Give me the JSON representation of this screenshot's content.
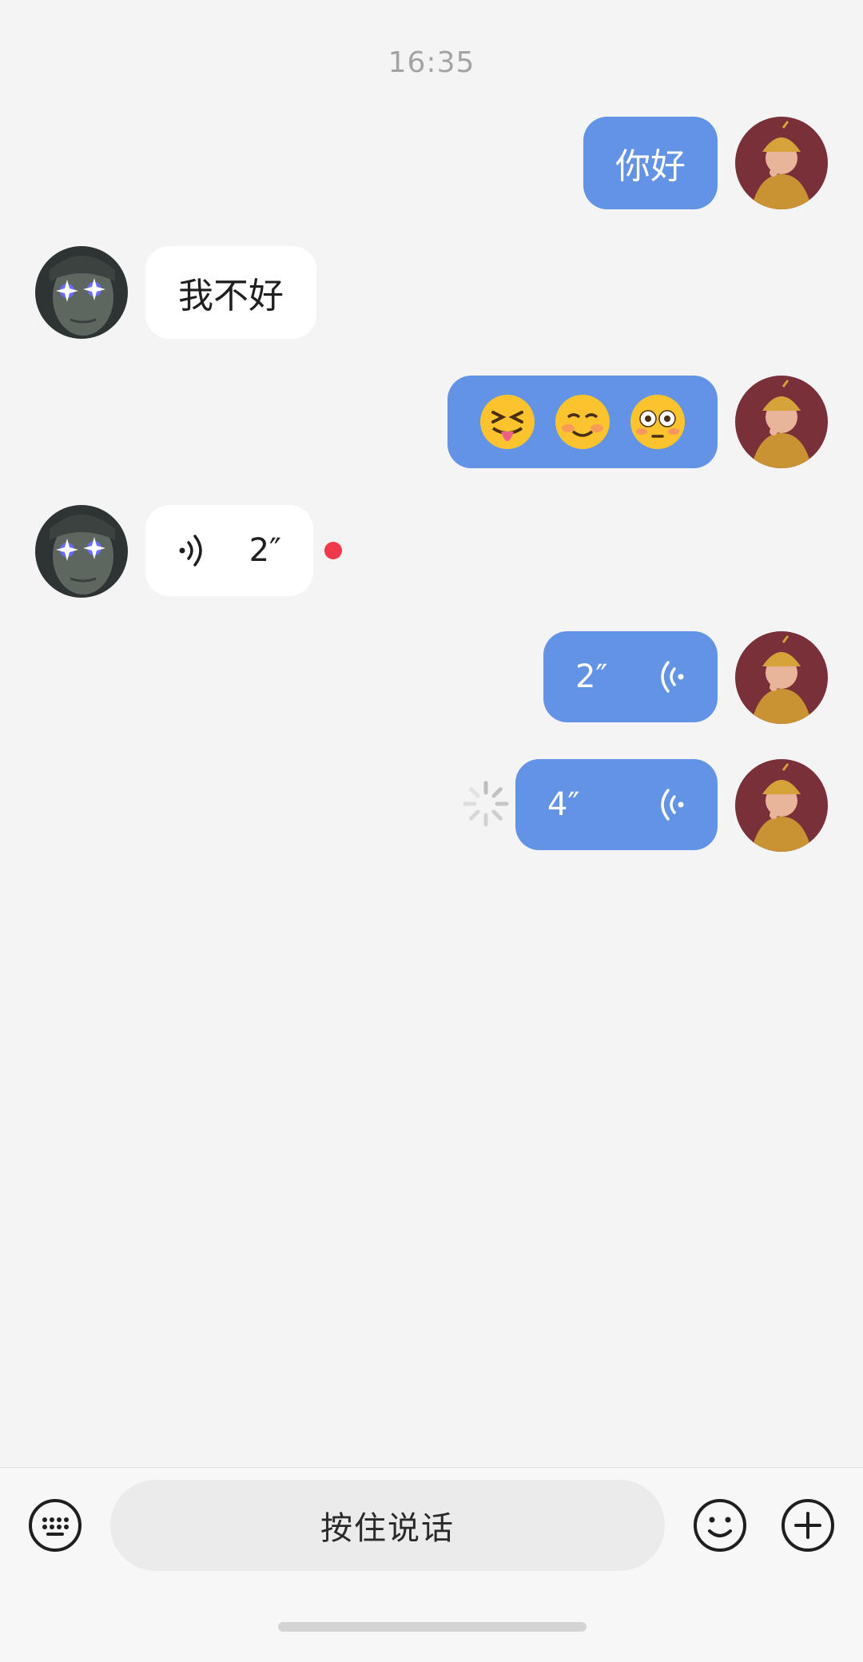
{
  "chat": {
    "timestamp": "16:35",
    "messages": [
      {
        "sender": "me",
        "type": "text",
        "text": "你好"
      },
      {
        "sender": "them",
        "type": "text",
        "text": "我不好"
      },
      {
        "sender": "me",
        "type": "emoji",
        "emojis": [
          "squinting-tongue-face",
          "smiling-face",
          "flushed-face"
        ]
      },
      {
        "sender": "them",
        "type": "voice",
        "duration": "2″",
        "unread": true
      },
      {
        "sender": "me",
        "type": "voice",
        "duration": "2″"
      },
      {
        "sender": "me",
        "type": "voice",
        "duration": "4″",
        "sending": true
      }
    ]
  },
  "input_bar": {
    "hold_to_talk_label": "按住说话",
    "icons": [
      "keyboard-icon",
      "emoji-icon",
      "plus-icon"
    ]
  },
  "colors": {
    "my_bubble": "#6293e4",
    "their_bubble": "#ffffff",
    "background": "#f4f4f5",
    "unread_dot": "#ee3a4a"
  }
}
